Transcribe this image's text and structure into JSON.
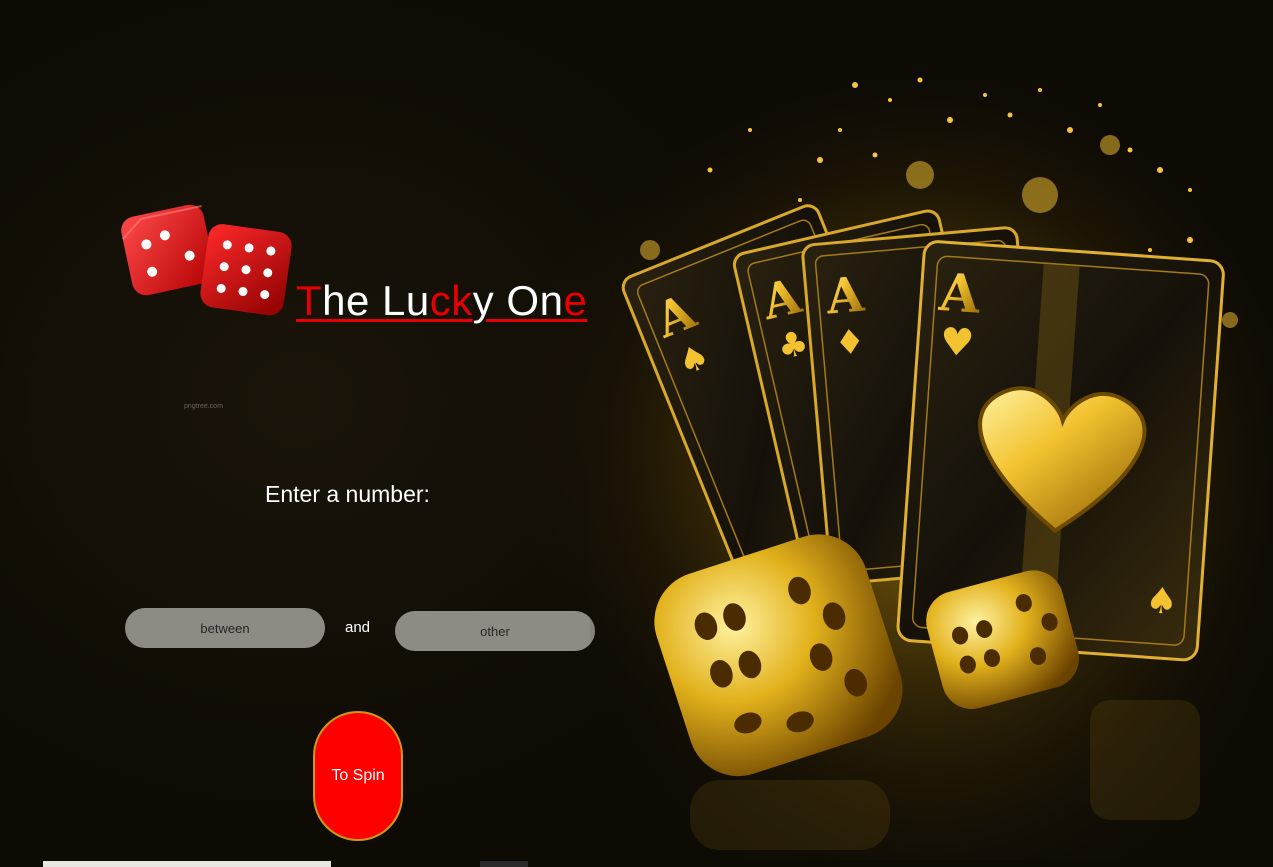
{
  "header": {
    "title_parts": [
      {
        "text": "T",
        "color": "red"
      },
      {
        "text": "he Lu",
        "color": "white"
      },
      {
        "text": "ck",
        "color": "red"
      },
      {
        "text": "y On",
        "color": "white"
      },
      {
        "text": "e",
        "color": "red"
      }
    ],
    "logo_icon": "red-dice-icon"
  },
  "credit": "pngtree.com",
  "form": {
    "prompt": "Enter a number:",
    "min_placeholder": "between",
    "connector": "and",
    "max_placeholder": "other",
    "spin_label": "To Spin"
  },
  "hero": {
    "icon": "golden-aces-and-dice-illustration"
  },
  "colors": {
    "accent_red": "#e60000",
    "button_red": "#ff0000",
    "gold": "#d4a017",
    "input_gray": "#8e8b84"
  }
}
